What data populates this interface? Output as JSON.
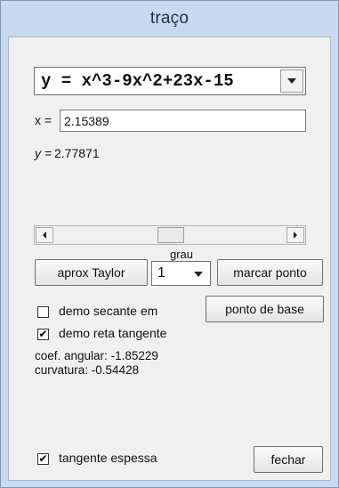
{
  "window": {
    "title": "traço"
  },
  "equation": {
    "selected": "y = x^3-9x^2+23x-15"
  },
  "x_field": {
    "label": "x =",
    "value": "2.15389"
  },
  "y_readout": {
    "label": "y =",
    "value": "2.77871"
  },
  "slider": {
    "position_fraction": 0.5
  },
  "taylor": {
    "grau_label": "grau",
    "button_label": "aprox Taylor",
    "degree_selected": "1"
  },
  "buttons": {
    "mark_point": "marcar ponto",
    "base_point": "ponto de base",
    "close": "fechar"
  },
  "checkboxes": {
    "secant": {
      "label": "demo secante em",
      "checked": false
    },
    "tangent": {
      "label": "demo reta tangente",
      "checked": true
    },
    "thick": {
      "label": "tangente espessa",
      "checked": true
    }
  },
  "stats": {
    "slope_label": "coef. angular:",
    "slope_value": "-1.85229",
    "curvature_label": "curvatura:",
    "curvature_value": "-0.54428"
  }
}
